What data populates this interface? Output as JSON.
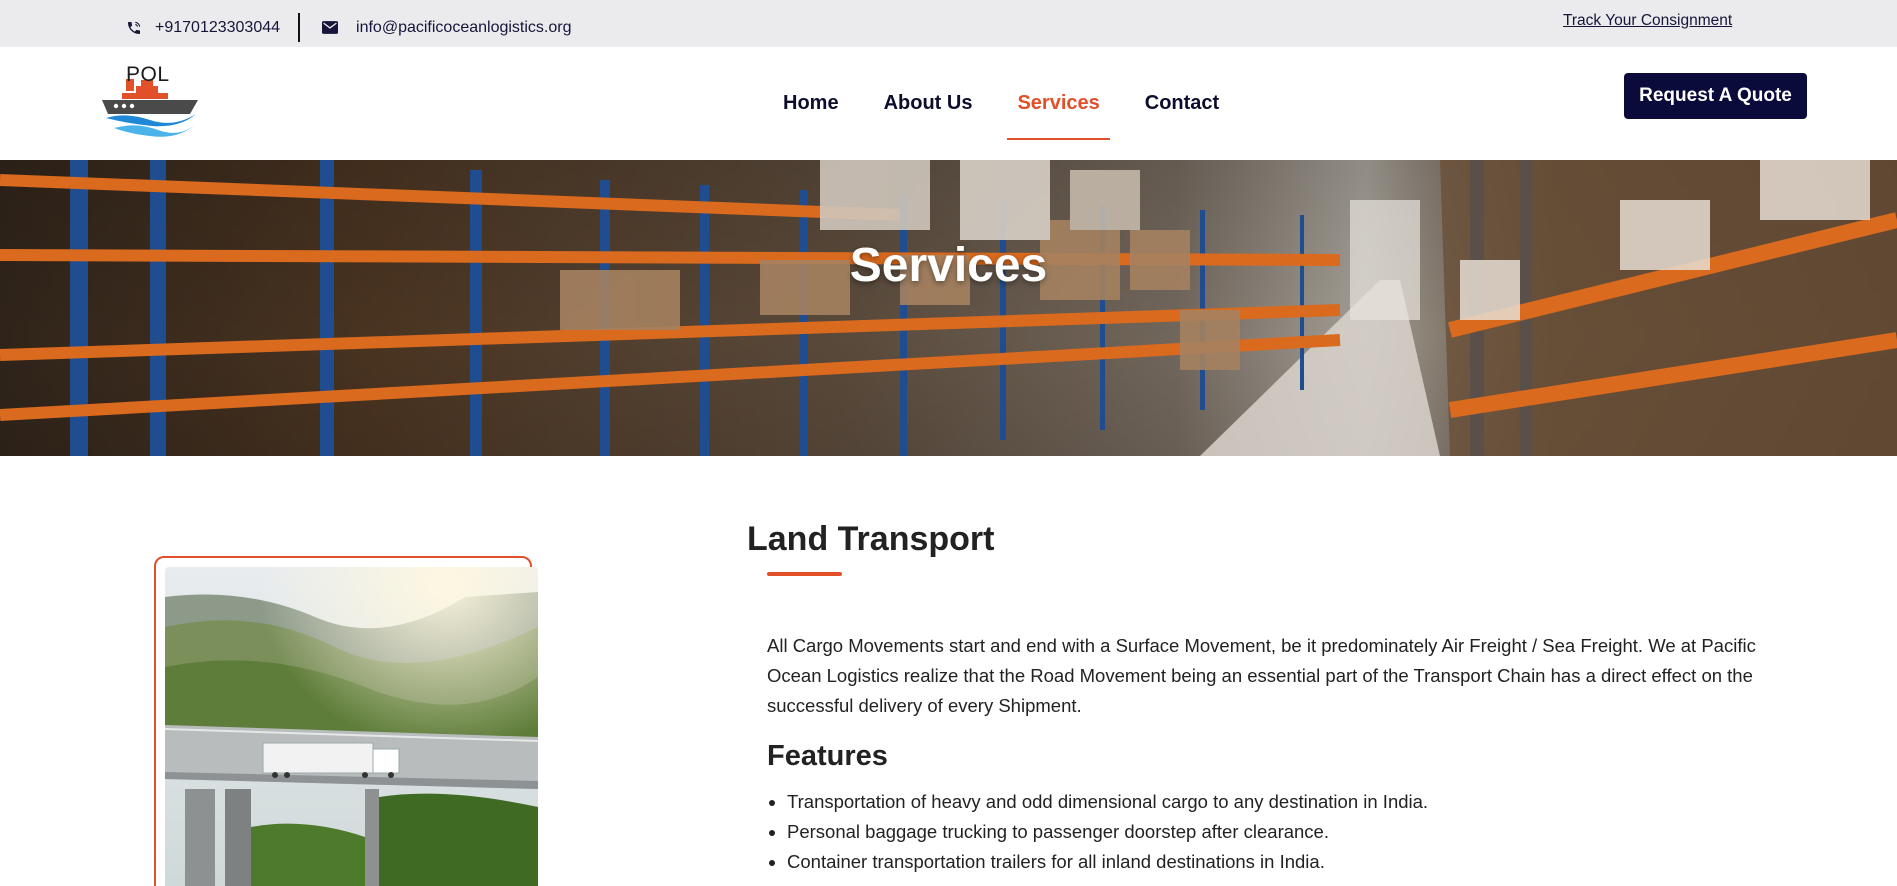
{
  "topbar": {
    "phone": "+9170123303044",
    "email": "info@pacificoceanlogistics.org",
    "track_link": "Track Your Consignment"
  },
  "header": {
    "logo_text": "POL",
    "nav": [
      {
        "label": "Home",
        "active": false
      },
      {
        "label": "About Us",
        "active": false
      },
      {
        "label": "Services",
        "active": true
      },
      {
        "label": "Contact",
        "active": false
      }
    ],
    "quote_button": "Request A Quote"
  },
  "hero": {
    "title": "Services"
  },
  "content": {
    "title": "Land Transport",
    "paragraph": "All Cargo Movements start and end with a Surface Movement, be it predominately Air Freight / Sea Freight. We at Pacific Ocean Logistics realize that the Road Movement being an essential part of the Transport Chain has a direct effect on the successful delivery of every Shipment.",
    "features_title": "Features",
    "features": [
      "Transportation of heavy and odd dimensional cargo to any destination in India.",
      "Personal baggage trucking to passenger doorstep after clearance.",
      "Container transportation trailers for all inland destinations in India."
    ]
  },
  "colors": {
    "accent": "#e2502a",
    "navy": "#0b0b3b",
    "topbar_bg": "#ebebee"
  },
  "icons": {
    "phone": "phone-icon",
    "mail": "mail-icon"
  }
}
